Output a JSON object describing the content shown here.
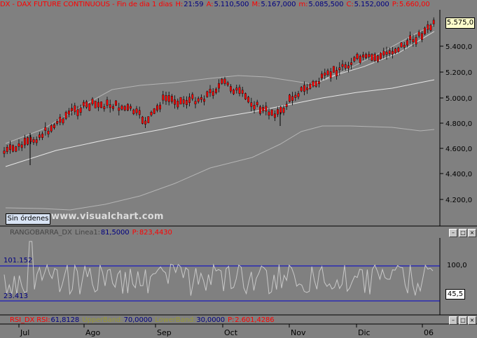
{
  "header": {
    "symbol": "DX - DAX FUTURE CONTINUOUS - Fin de dia 1 dias",
    "hour_label": "H:",
    "hour": "21:59",
    "open_label": "A:",
    "open": "5.110,500",
    "high_label": "M:",
    "high": "5.167,000",
    "low_label": "m:",
    "low": "5.085,500",
    "close_label": "C:",
    "close": "5.152,000",
    "p_label": "P:",
    "p_value": "5.660,00"
  },
  "price_axis": {
    "ticks": [
      "5.400,0",
      "5.200,0",
      "5.000,0",
      "4.800,0",
      "4.600,0",
      "4.400,0",
      "4.200,0"
    ],
    "current": "5.575,0"
  },
  "orders_button": "Sin órdenes",
  "watermark": "www.visualchart.com",
  "range_panel": {
    "name": "RANGOBARRA_DX",
    "line_label": "Linea1:",
    "line_value": "81,5000",
    "p_label": "P:",
    "p_value": "823,4430",
    "level_high_label": "101.152",
    "level_low_label": "23.413",
    "axis_tick": "100,0",
    "current": "45,5"
  },
  "rsi_panel": {
    "name": "RSI_DX RSI:",
    "rsi_value": "61,8128",
    "upper_label": "UpperBand:",
    "upper_value": "70,0000",
    "lower_label": "LowerBand:",
    "lower_value": "30,0000",
    "p_label": "P:",
    "p_value": "2.601,4286"
  },
  "x_axis": {
    "months": [
      "Jul",
      "Ago",
      "Sep",
      "Oct",
      "Nov",
      "Dic",
      "06"
    ]
  },
  "colors": {
    "background": "#808080",
    "candle": "#ff0000",
    "bands": "#b4b4b4",
    "level_lines": "#0000cc",
    "text_red": "#ff0000",
    "text_navy": "#000080"
  }
}
